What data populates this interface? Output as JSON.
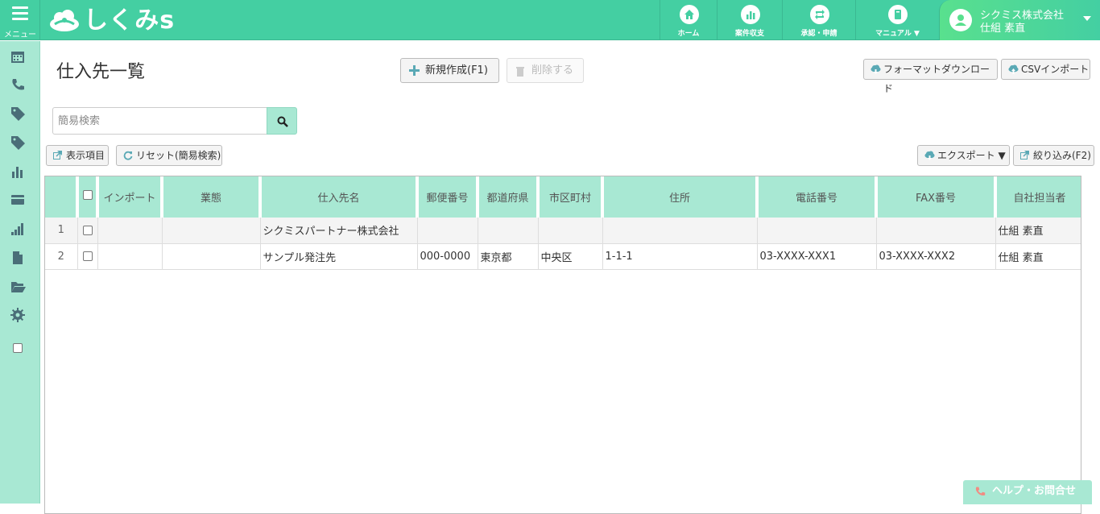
{
  "topbar": {
    "menu_label": "メニュー",
    "logo_text": "しくみs",
    "nav": [
      {
        "label": "ホーム",
        "icon": "home-icon"
      },
      {
        "label": "案件収支",
        "icon": "bar-chart-icon"
      },
      {
        "label": "承認・申請",
        "icon": "retweet-icon"
      },
      {
        "label": "マニュアル ▼",
        "icon": "book-icon"
      }
    ],
    "user": {
      "company": "シクミス株式会社",
      "name": "仕組 素直"
    }
  },
  "sidebar": {
    "icons": [
      "calendar-icon",
      "phone-icon",
      "tags-icon",
      "tags-icon",
      "bar-chart-icon",
      "credit-card-icon",
      "signal-icon",
      "file-icon",
      "folder-open-icon",
      "gear-icon",
      "checkbox-icon"
    ]
  },
  "page": {
    "title": "仕入先一覧",
    "new_label": "新規作成(F1)",
    "delete_label": "削除する",
    "format_download_label": "フォーマットダウンロード",
    "csv_import_label": "CSVインポート",
    "search_placeholder": "簡易検索",
    "display_items_label": "表示項目",
    "reset_label": "リセット(簡易検索)",
    "export_label": "エクスポート ▼",
    "filter_label": "絞り込み(F2)"
  },
  "table": {
    "columns": [
      "",
      "",
      "インポート",
      "業態",
      "仕入先名",
      "郵便番号",
      "都道府県",
      "市区町村",
      "住所",
      "電話番号",
      "FAX番号",
      "自社担当者"
    ],
    "rows": [
      {
        "num": "1",
        "import": "",
        "type": "",
        "name": "シクミスパートナー株式会社",
        "zip": "",
        "pref": "",
        "city": "",
        "address": "",
        "tel": "",
        "fax": "",
        "staff": "仕組 素直"
      },
      {
        "num": "2",
        "import": "",
        "type": "",
        "name": "サンプル発注先",
        "zip": "000-0000",
        "pref": "東京都",
        "city": "中央区",
        "address": "1-1-1",
        "tel": "03-XXXX-XXX1",
        "fax": "03-XXXX-XXX2",
        "staff": "仕組 素直"
      }
    ]
  },
  "help": {
    "label": "ヘルプ・お問合せ"
  },
  "colors": {
    "accent": "#44cfa2",
    "light": "#a8e8d3"
  }
}
